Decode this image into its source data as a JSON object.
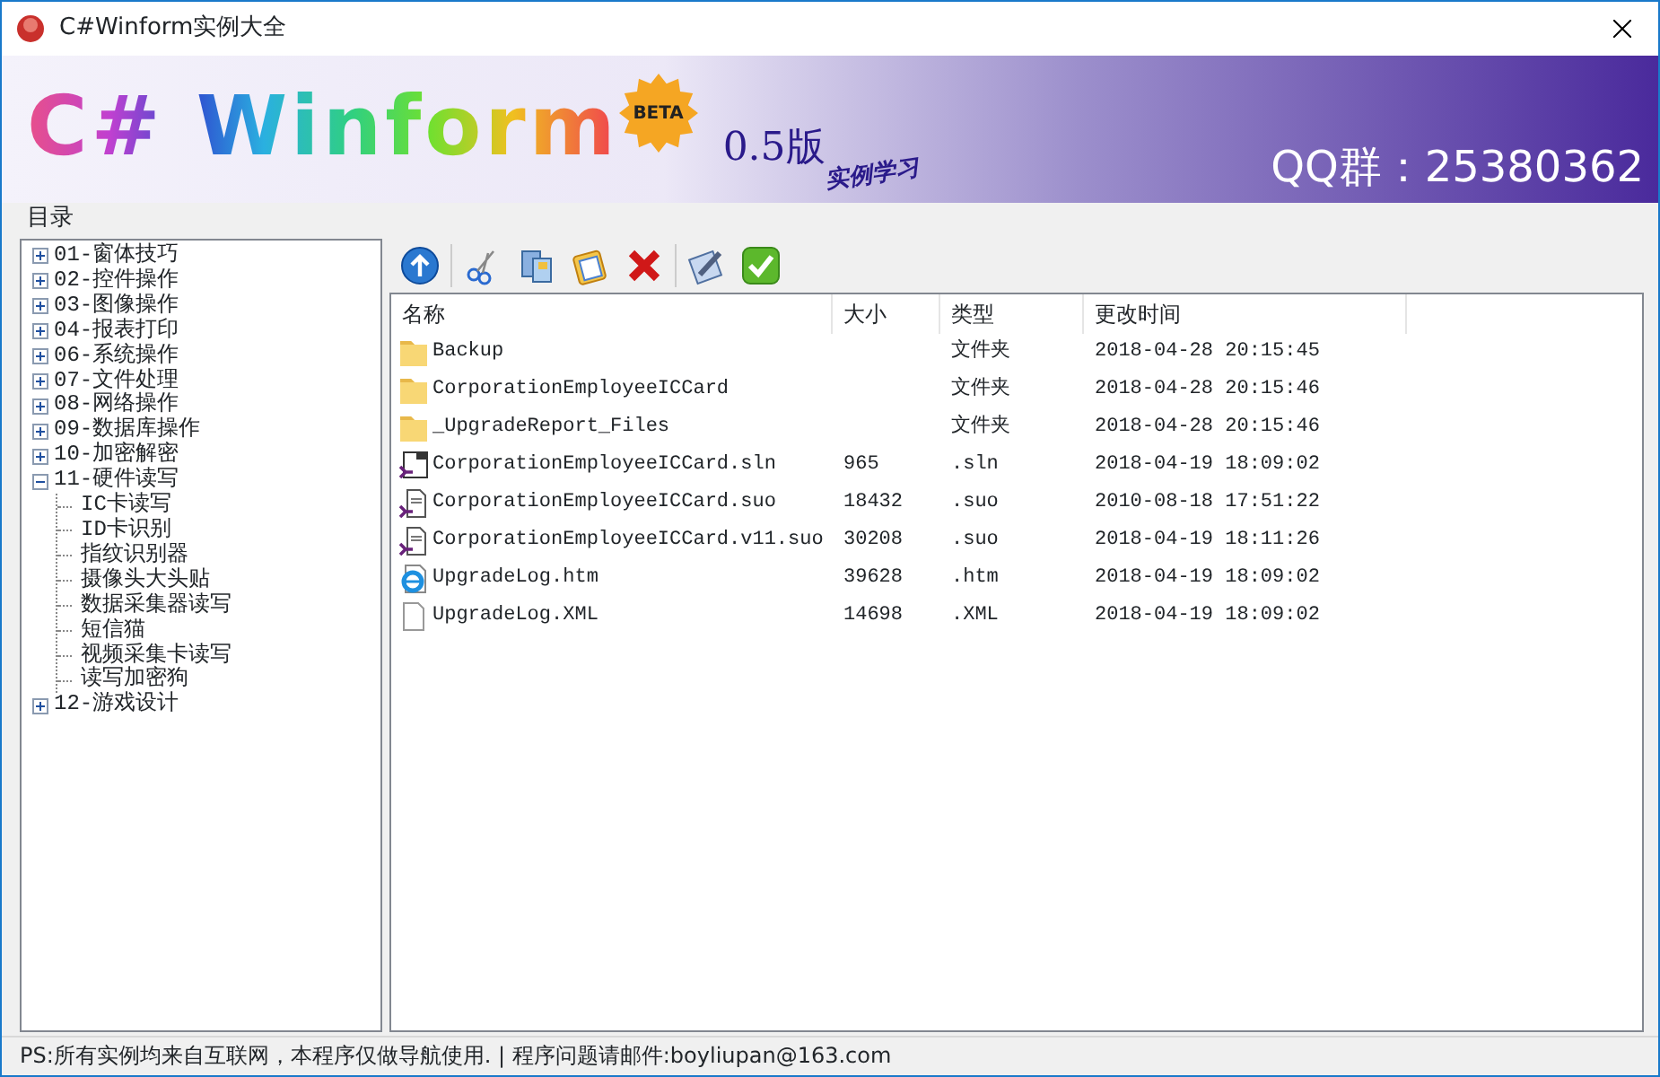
{
  "window": {
    "title": "C#Winform实例大全"
  },
  "banner": {
    "logo": "C# Winform",
    "badge": "BETA",
    "version": "0.5版",
    "tagline": "实例学习",
    "qq": "QQ群：25380362"
  },
  "sidebar": {
    "title": "目录",
    "tree": [
      {
        "label": "01-窗体技巧",
        "expanded": false
      },
      {
        "label": "02-控件操作",
        "expanded": false
      },
      {
        "label": "03-图像操作",
        "expanded": false
      },
      {
        "label": "04-报表打印",
        "expanded": false
      },
      {
        "label": "06-系统操作",
        "expanded": false
      },
      {
        "label": "07-文件处理",
        "expanded": false
      },
      {
        "label": "08-网络操作",
        "expanded": false
      },
      {
        "label": "09-数据库操作",
        "expanded": false
      },
      {
        "label": "10-加密解密",
        "expanded": false
      },
      {
        "label": "11-硬件读写",
        "expanded": true,
        "children": [
          {
            "label": "IC卡读写"
          },
          {
            "label": "ID卡识别"
          },
          {
            "label": "指纹识别器"
          },
          {
            "label": "摄像头大头贴"
          },
          {
            "label": "数据采集器读写"
          },
          {
            "label": "短信猫"
          },
          {
            "label": "视频采集卡读写"
          },
          {
            "label": "读写加密狗"
          }
        ]
      },
      {
        "label": "12-游戏设计",
        "expanded": false
      }
    ]
  },
  "file_list": {
    "columns": [
      "名称",
      "大小",
      "类型",
      "更改时间"
    ],
    "rows": [
      {
        "kind": "folder",
        "name": "Backup",
        "type": "文件夹",
        "modified": "2018-04-28 20:15:45"
      },
      {
        "kind": "folder",
        "name": "CorporationEmployeeICCard",
        "type": "文件夹",
        "modified": "2018-04-28 20:15:46"
      },
      {
        "kind": "folder",
        "name": "_UpgradeReport_Files",
        "type": "文件夹",
        "modified": "2018-04-28 20:15:46"
      },
      {
        "kind": "solution",
        "name": "CorporationEmployeeICCard.sln",
        "size": "965",
        "type": ".sln",
        "modified": "2018-04-19 18:09:02"
      },
      {
        "kind": "vsfile",
        "name": "CorporationEmployeeICCard.suo",
        "size": "18432",
        "type": ".suo",
        "modified": "2010-08-18 17:51:22"
      },
      {
        "kind": "vsfile",
        "name": "CorporationEmployeeICCard.v11.suo",
        "size": "30208",
        "type": ".suo",
        "modified": "2018-04-19 18:11:26"
      },
      {
        "kind": "web",
        "name": "UpgradeLog.htm",
        "size": "39628",
        "type": ".htm",
        "modified": "2018-04-19 18:09:02"
      },
      {
        "kind": "document",
        "name": "UpgradeLog.XML",
        "size": "14698",
        "type": ".XML",
        "modified": "2018-04-19 18:09:02"
      }
    ]
  },
  "status_bar": {
    "text": "PS:所有实例均来自互联网，本程序仅做导航使用.  |  程序问题请邮件:boyliupan@163.com"
  }
}
